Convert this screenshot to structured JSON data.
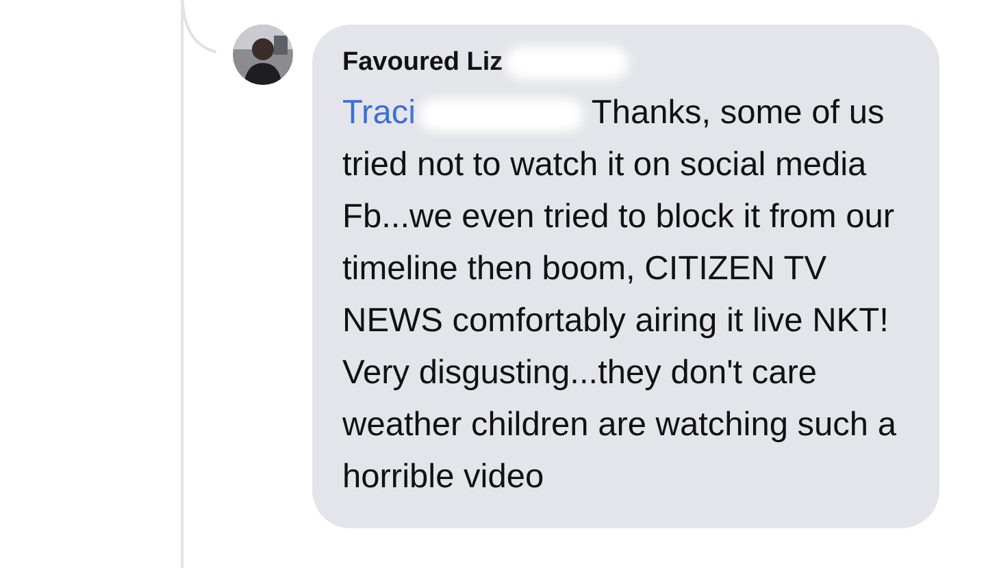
{
  "comment": {
    "author": "Favoured Liz",
    "mention": "Traci",
    "text": "Thanks, some of us tried not to watch it on social media Fb...we even tried to block it from our timeline then boom, CITIZEN TV NEWS comfortably airing it live NKT! Very disgusting...they don't care weather children are watching such a horrible video"
  }
}
